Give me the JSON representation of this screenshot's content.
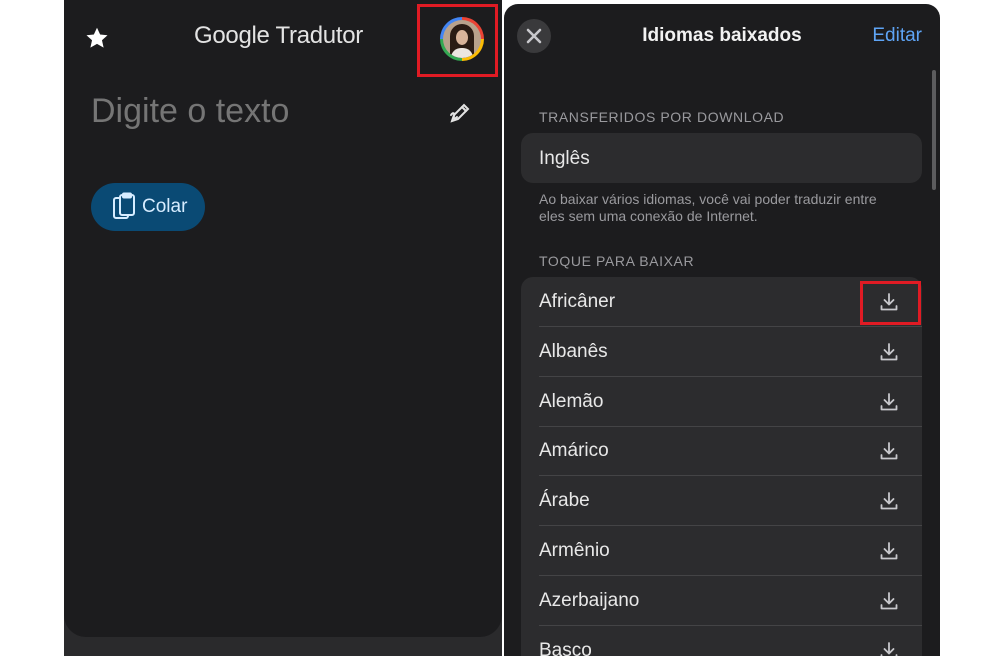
{
  "left": {
    "app_title_brand": "Google",
    "app_title_product": "Tradutor",
    "input_placeholder": "Digite o texto",
    "paste_label": "Colar",
    "icons": [
      "star-icon",
      "avatar",
      "handwrite-icon",
      "clipboard-icon"
    ]
  },
  "right": {
    "title": "Idiomas baixados",
    "edit_label": "Editar",
    "downloaded_header": "TRANSFERIDOS POR DOWNLOAD",
    "downloaded_languages": [
      "Inglês"
    ],
    "info_text": "Ao baixar vários idiomas, você vai poder traduzir entre eles sem uma conexão de Internet.",
    "tap_header": "TOQUE PARA BAIXAR",
    "available_languages": [
      "Africâner",
      "Albanês",
      "Alemão",
      "Amárico",
      "Árabe",
      "Armênio",
      "Azerbaijano",
      "Basco"
    ],
    "icons": [
      "close-icon",
      "download-icon"
    ]
  },
  "colors": {
    "highlight": "#e01b24",
    "accent": "#5ea4f5",
    "paste_button": "#0a4a74"
  }
}
